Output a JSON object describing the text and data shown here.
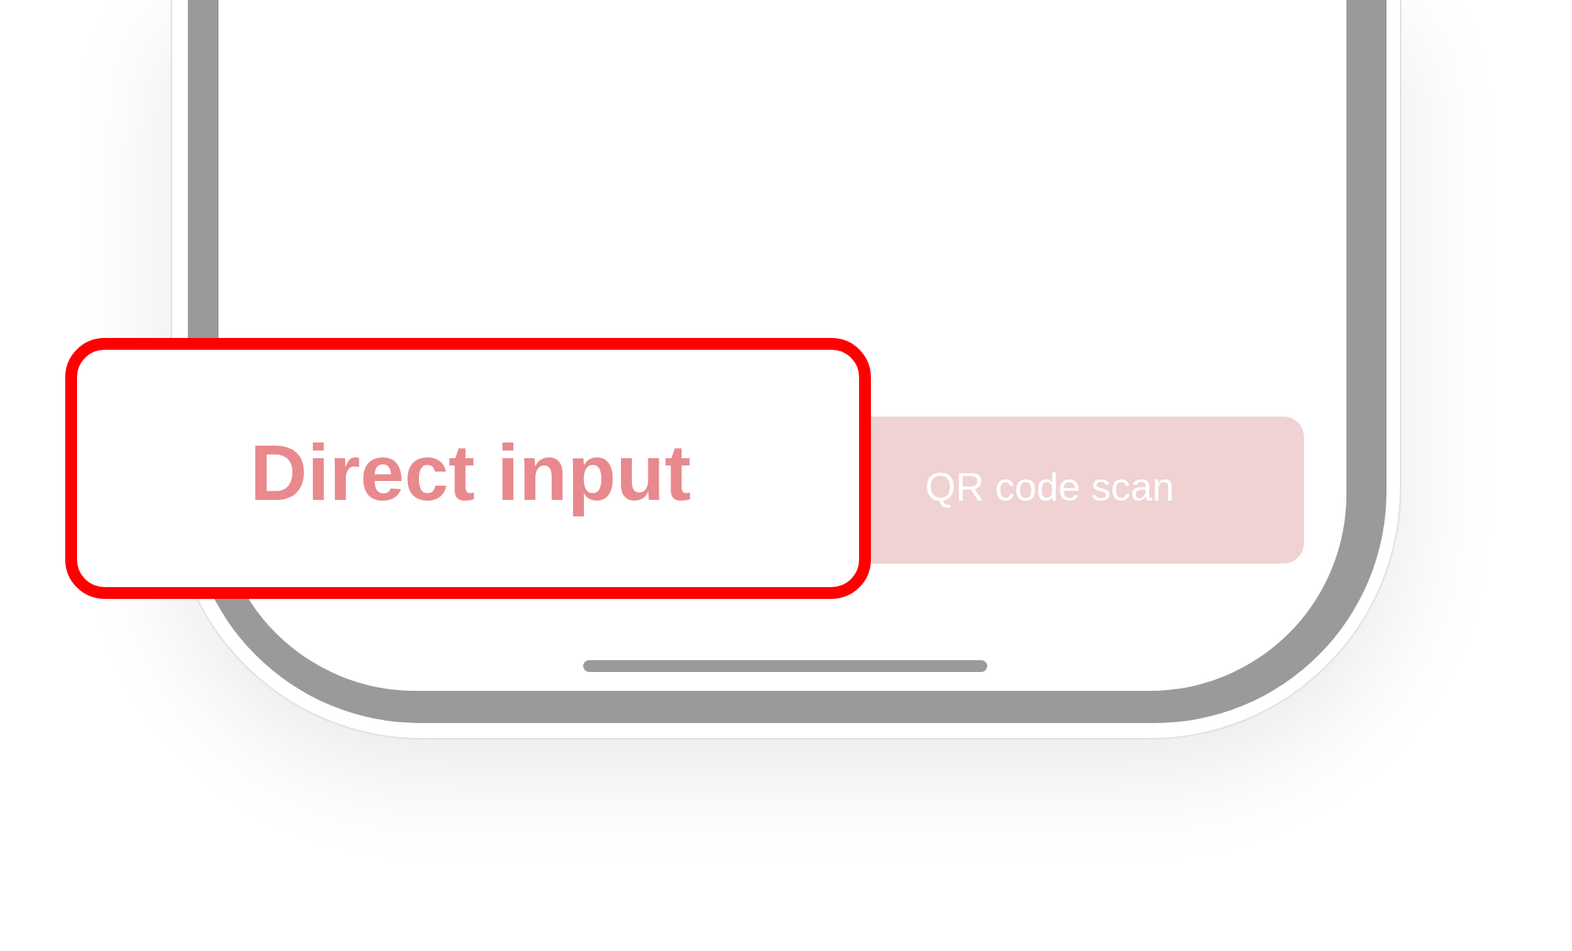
{
  "screen": {
    "buttons": [
      {
        "label": "QR code scan"
      }
    ]
  },
  "callout": {
    "label": "Direct input"
  }
}
